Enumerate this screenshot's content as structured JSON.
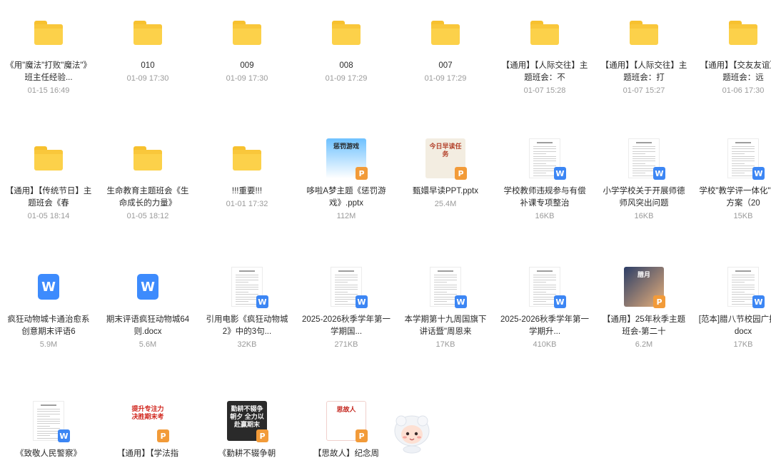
{
  "rows": [
    [
      {
        "type": "folder",
        "name": "《用\"魔法\"打败\"魔法\"》班主任经验...",
        "meta": "01-15 16:49"
      },
      {
        "type": "folder",
        "name": "010",
        "meta": "01-09 17:30"
      },
      {
        "type": "folder",
        "name": "009",
        "meta": "01-09 17:30"
      },
      {
        "type": "folder",
        "name": "008",
        "meta": "01-09 17:29"
      },
      {
        "type": "folder",
        "name": "007",
        "meta": "01-09 17:29"
      },
      {
        "type": "folder",
        "name": "【通用】【人际交往】主题班会：不",
        "meta": "01-07 15:28"
      },
      {
        "type": "folder",
        "name": "【通用】【人际交往】主题班会：打",
        "meta": "01-07 15:27"
      },
      {
        "type": "folder",
        "name": "【通用】【交友友谊】主题班会：远",
        "meta": "01-06 17:30"
      }
    ],
    [
      {
        "type": "folder",
        "name": "【通用】【传统节日】主题班会《春",
        "meta": "01-05 18:14"
      },
      {
        "type": "folder",
        "name": "生命教育主题班会《生命成长的力量》",
        "meta": "01-05 18:12"
      },
      {
        "type": "folder",
        "name": "!!!重要!!!",
        "meta": "01-01 17:32"
      },
      {
        "type": "ppt",
        "thumb": "game",
        "name": "哆啦A梦主题《惩罚游戏》.pptx",
        "meta": "112M",
        "thumb_text": "惩罚游戏"
      },
      {
        "type": "ppt",
        "thumb": "reading",
        "name": "甄嬛早读PPT.pptx",
        "meta": "25.4M",
        "thumb_text": "今日早读任务"
      },
      {
        "type": "doc",
        "name": "学校教师违规参与有偿补课专项整治",
        "meta": "16KB"
      },
      {
        "type": "doc",
        "name": "小学学校关于开展师德师风突出问题",
        "meta": "16KB"
      },
      {
        "type": "doc",
        "name": "学校\"教学评一体化\"实施方案（20",
        "meta": "15KB"
      }
    ],
    [
      {
        "type": "word",
        "name": "疯狂动物城卡通治愈系创意期末评语6",
        "meta": "5.9M"
      },
      {
        "type": "word",
        "name": "期末评语疯狂动物城64则.docx",
        "meta": "5.6M"
      },
      {
        "type": "doc",
        "name": "引用电影《疯狂动物城 2》中的3句...",
        "meta": "32KB"
      },
      {
        "type": "doc",
        "name": "2025-2026秋季学年第一学期国...",
        "meta": "271KB"
      },
      {
        "type": "doc",
        "name": "本学期第十九周国旗下讲话暨\"周恩来",
        "meta": "17KB"
      },
      {
        "type": "doc",
        "name": "2025-2026秋季学年第一学期升...",
        "meta": "410KB"
      },
      {
        "type": "ppt",
        "thumb": "art",
        "name": "【通用】25年秋季主题班会-第二十",
        "meta": "6.2M",
        "thumb_text": "腊月"
      },
      {
        "type": "doc",
        "name": "[范本]腊八节校园广播稿.docx",
        "meta": "17KB"
      }
    ],
    [
      {
        "type": "doc",
        "name": "《致敬人民警察》",
        "meta": ""
      },
      {
        "type": "ppt",
        "thumb": "focus",
        "name": "【通用】【学法指",
        "meta": "",
        "thumb_text": "提升专注力 决胜期末考"
      },
      {
        "type": "ppt",
        "thumb": "dark",
        "name": "《勤耕不辍争朝",
        "meta": "",
        "thumb_text": "勤耕不辍争朝夕 全力以赴赢期末"
      },
      {
        "type": "ppt",
        "thumb": "red",
        "name": "【思故人】纪念周",
        "meta": "",
        "thumb_text": "思故人"
      }
    ]
  ],
  "icons": {
    "folder": "folder-icon",
    "word": "word-file-icon",
    "ppt": "ppt-file-icon",
    "doc": "document-thumbnail",
    "mascot": "assistant-mascot-icon"
  },
  "badges": {
    "word": "W",
    "ppt": "P"
  },
  "colors": {
    "folder": "#fcd14a",
    "word": "#3c86f4",
    "ppt": "#f29b39",
    "meta": "#9a9a9a"
  }
}
